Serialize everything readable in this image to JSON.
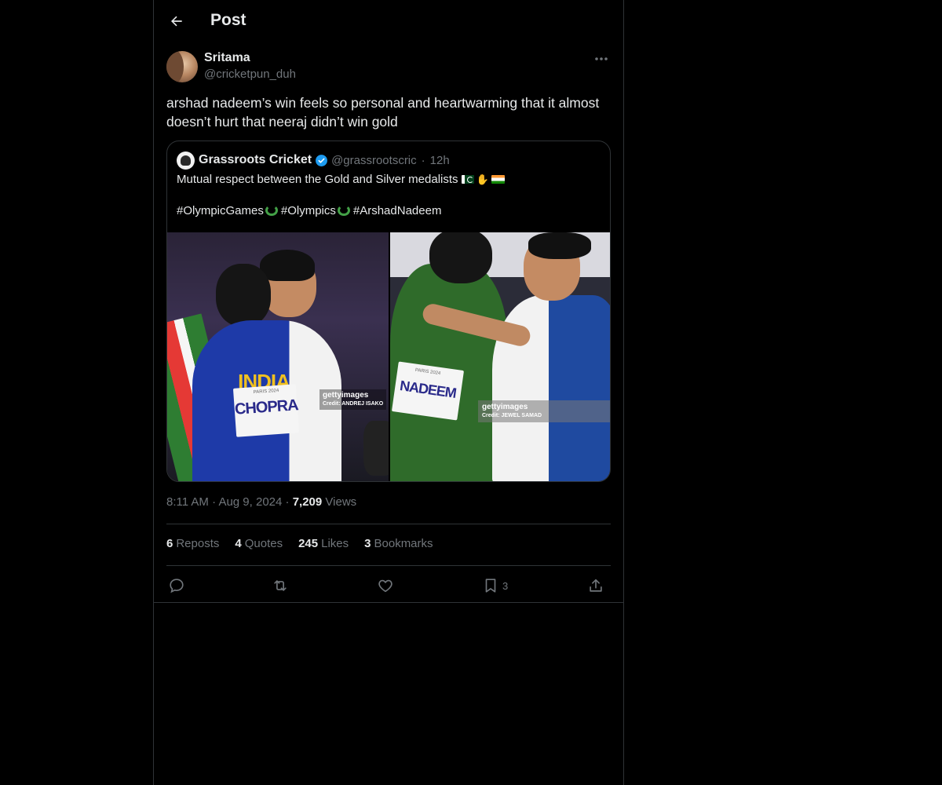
{
  "header": {
    "title": "Post",
    "back_icon": "arrow-left-icon"
  },
  "post": {
    "author_name": "Sritama",
    "author_handle": "@cricketpun_duh",
    "text": "arshad nadeem’s win feels so personal and heartwarming that it almost doesn’t hurt that neeraj didn’t win gold",
    "time": "8:11 AM",
    "date": "Aug 9, 2024",
    "views_count": "7,209",
    "views_label": "Views"
  },
  "quote": {
    "name": "Grassroots Cricket",
    "handle": "@grassrootscric",
    "time": "12h",
    "line1": "Mutual respect between the Gold and Silver medalists",
    "tag1": "#OlympicGames",
    "tag2": "#Olympics",
    "tag3": "#ArshadNadeem",
    "media": [
      {
        "brand": "gettyimages",
        "credit": "Credit: ANDREJ ISAKO",
        "jersey_text": "INDIA",
        "bib_text": "CHOPRA",
        "bib_small": "PARIS 2024"
      },
      {
        "brand": "gettyimages",
        "credit": "Credit: JEWEL SAMAD",
        "bib_text": "NADEEM",
        "bib_small": "PARIS 2024"
      }
    ]
  },
  "stats": [
    {
      "count": "6",
      "label": "Reposts"
    },
    {
      "count": "4",
      "label": "Quotes"
    },
    {
      "count": "245",
      "label": "Likes"
    },
    {
      "count": "3",
      "label": "Bookmarks"
    }
  ],
  "actions": {
    "bookmark_count": "3"
  },
  "colors": {
    "background": "#000000",
    "text": "#e7e9ea",
    "muted": "#71767b",
    "border": "#2f3336",
    "verified": "#1d9bf0"
  }
}
